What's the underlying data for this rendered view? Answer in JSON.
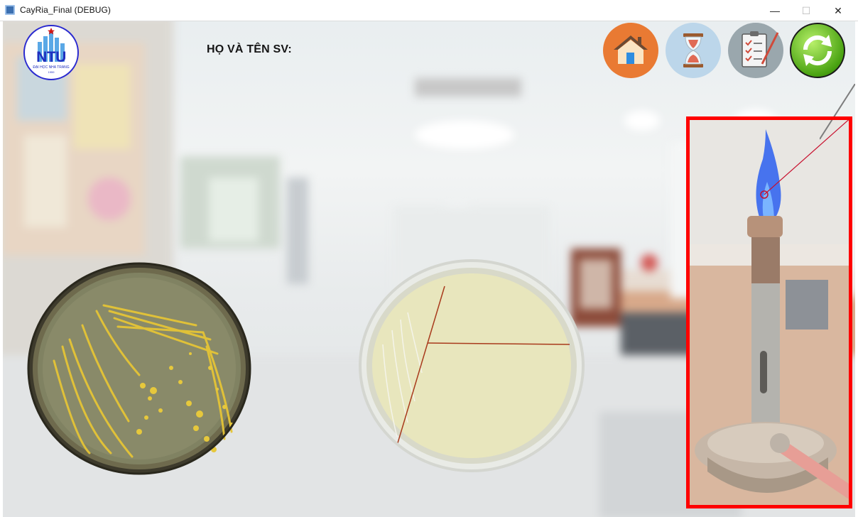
{
  "window": {
    "title": "CayRia_Final (DEBUG)",
    "minimize_glyph": "—",
    "maximize_glyph": "☐",
    "close_glyph": "✕"
  },
  "header": {
    "student_label": "HỌ VÀ TÊN SV:",
    "logo_text": "NTU",
    "logo_subtext": "ĐẠI HỌC NHA TRANG",
    "logo_year": "1959"
  },
  "toolbar": {
    "buttons": [
      {
        "name": "home",
        "icon": "home-icon",
        "color": "#e97a33"
      },
      {
        "name": "timer",
        "icon": "hourglass-icon",
        "color": "#bcd6ea"
      },
      {
        "name": "checklist",
        "icon": "clipboard-icon",
        "color": "#9aa7ad"
      },
      {
        "name": "reset",
        "icon": "refresh-icon",
        "color": "#64c21e"
      }
    ]
  },
  "workspace": {
    "source_plate": "colony-petri-dish",
    "target_plate": "streaked-petri-dish",
    "burner": "bunsen-burner",
    "highlight_color": "#ff0000"
  }
}
